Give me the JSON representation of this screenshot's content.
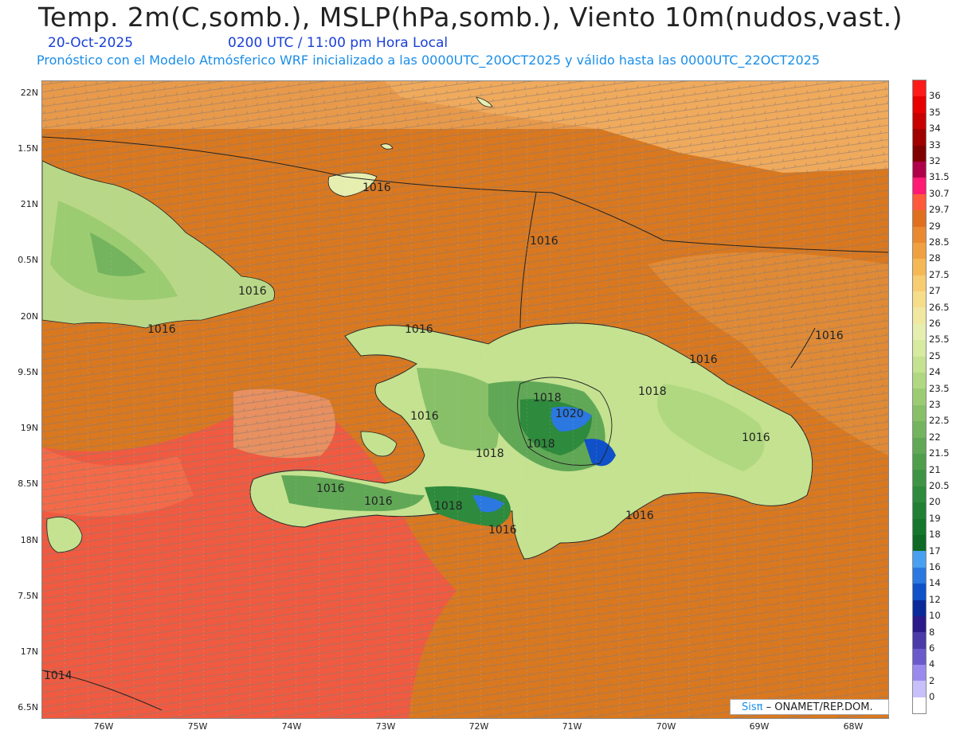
{
  "header": {
    "title": "Temp. 2m(C,somb.), MSLP(hPa,somb.), Viento 10m(nudos,vast.)",
    "date": "20-Oct-2025",
    "time": "0200 UTC / 11:00 pm Hora Local",
    "description": "Pronóstico con el Modelo Atmósferico WRF inicializado a las 0000UTC_20OCT2025 y válido hasta las  0000UTC_22OCT2025"
  },
  "axes": {
    "lat_labels": [
      "22N",
      "1.5N",
      "21N",
      "0.5N",
      "20N",
      "9.5N",
      "19N",
      "8.5N",
      "18N",
      "7.5N",
      "17N",
      "6.5N"
    ],
    "lon_labels": [
      "76W",
      "75W",
      "74W",
      "73W",
      "72W",
      "71W",
      "70W",
      "69W",
      "68W"
    ]
  },
  "isobars": [
    "1016",
    "1016",
    "1016",
    "1016",
    "1016",
    "1016",
    "1018",
    "1020",
    "1018",
    "1018",
    "1016",
    "1018",
    "1016",
    "1016",
    "1018",
    "1016",
    "1016",
    "1016",
    "1016",
    "1014"
  ],
  "colorbar": {
    "labels": [
      "36",
      "35",
      "34",
      "33",
      "32",
      "31.5",
      "30.7",
      "29.7",
      "29",
      "28.5",
      "28",
      "27.5",
      "27",
      "26.5",
      "26",
      "25.5",
      "25",
      "24",
      "23.5",
      "23",
      "22.5",
      "22",
      "21.5",
      "21",
      "20.5",
      "20",
      "19",
      "18",
      "17",
      "16",
      "14",
      "12",
      "10",
      "8",
      "6",
      "4",
      "2",
      "0"
    ],
    "colors": [
      "#ff1a1a",
      "#e60000",
      "#c80000",
      "#a00000",
      "#800000",
      "#b0004a",
      "#ff1a73",
      "#ff5a3c",
      "#e07020",
      "#ea8a30",
      "#f0a040",
      "#f5b855",
      "#f8cc70",
      "#f6dd8a",
      "#f0e8a0",
      "#e6eeb0",
      "#d6eaa0",
      "#c4e290",
      "#b0d880",
      "#9ccc72",
      "#88c068",
      "#74b45e",
      "#60a856",
      "#4e9e4c",
      "#3e9444",
      "#2e8a3c",
      "#228034",
      "#16762c",
      "#0e6a24",
      "#4aa0f0",
      "#2a78e0",
      "#1050c8",
      "#0a2a9a",
      "#2a1a8a",
      "#4a3aaa",
      "#6a5acc",
      "#9a8aee",
      "#c8c0fa",
      "#ffffff"
    ]
  },
  "credit": {
    "sis": "Sisπ",
    "rest": " – ONAMET/REP.DOM."
  }
}
